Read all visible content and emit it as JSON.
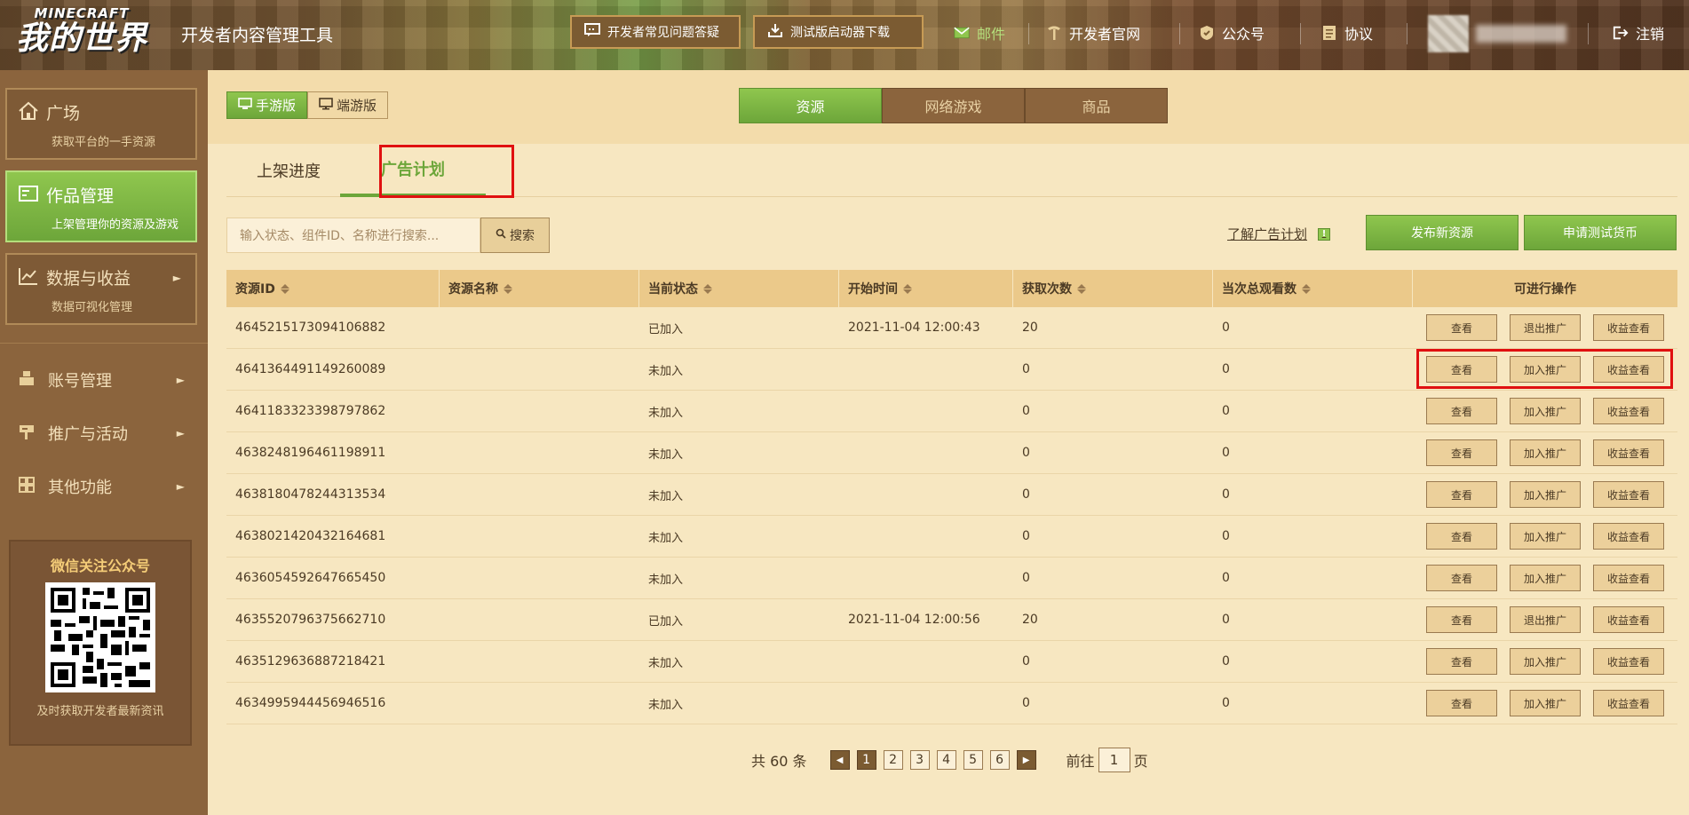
{
  "header": {
    "logo_en": "MINECRAFT",
    "logo_cn": "我的世界",
    "app_title": "开发者内容管理工具",
    "faq_btn": "开发者常见问题答疑",
    "download_btn": "测试版启动器下载",
    "mail": "邮件",
    "official_site": "开发者官网",
    "wechat_account": "公众号",
    "protocol": "协议",
    "logout": "注销"
  },
  "sidebar": {
    "plaza_title": "广场",
    "plaza_sub": "获取平台的一手资源",
    "works_title": "作品管理",
    "works_sub": "上架管理你的资源及游戏",
    "data_title": "数据与收益",
    "data_sub": "数据可视化管理",
    "account": "账号管理",
    "promo": "推广与活动",
    "other": "其他功能",
    "wechat_title": "微信关注公众号",
    "wechat_sub": "及时获取开发者最新资讯"
  },
  "platform": {
    "mobile": "手游版",
    "pc": "端游版"
  },
  "category_tabs": [
    "资源",
    "网络游戏",
    "商品"
  ],
  "tabs": {
    "progress": "上架进度",
    "ads": "广告计划"
  },
  "search": {
    "placeholder": "输入状态、组件ID、名称进行搜索...",
    "button": "搜索"
  },
  "learn_ads": "了解广告计划",
  "learn_icon": "!",
  "publish_btn": "发布新资源",
  "apply_btn": "申请测试货币",
  "table": {
    "headers": [
      "资源ID",
      "资源名称",
      "当前状态",
      "开始时间",
      "获取次数",
      "当次总观看数",
      "可进行操作"
    ],
    "rows": [
      {
        "id": "4645215173094106882",
        "name": "",
        "status": "已加入",
        "start": "2021-11-04 12:00:43",
        "count": "20",
        "views": "0",
        "ops": [
          "查看",
          "退出推广",
          "收益查看"
        ]
      },
      {
        "id": "4641364491149260089",
        "name": "",
        "status": "未加入",
        "start": "",
        "count": "0",
        "views": "0",
        "ops": [
          "查看",
          "加入推广",
          "收益查看"
        ]
      },
      {
        "id": "4641183323398797862",
        "name": "",
        "status": "未加入",
        "start": "",
        "count": "0",
        "views": "0",
        "ops": [
          "查看",
          "加入推广",
          "收益查看"
        ]
      },
      {
        "id": "4638248196461198911",
        "name": "",
        "status": "未加入",
        "start": "",
        "count": "0",
        "views": "0",
        "ops": [
          "查看",
          "加入推广",
          "收益查看"
        ]
      },
      {
        "id": "4638180478244313534",
        "name": "",
        "status": "未加入",
        "start": "",
        "count": "0",
        "views": "0",
        "ops": [
          "查看",
          "加入推广",
          "收益查看"
        ]
      },
      {
        "id": "4638021420432164681",
        "name": "",
        "status": "未加入",
        "start": "",
        "count": "0",
        "views": "0",
        "ops": [
          "查看",
          "加入推广",
          "收益查看"
        ]
      },
      {
        "id": "4636054592647665450",
        "name": "",
        "status": "未加入",
        "start": "",
        "count": "0",
        "views": "0",
        "ops": [
          "查看",
          "加入推广",
          "收益查看"
        ]
      },
      {
        "id": "4635520796375662710",
        "name": "",
        "status": "已加入",
        "start": "2021-11-04 12:00:56",
        "count": "20",
        "views": "0",
        "ops": [
          "查看",
          "退出推广",
          "收益查看"
        ]
      },
      {
        "id": "4635129636887218421",
        "name": "",
        "status": "未加入",
        "start": "",
        "count": "0",
        "views": "0",
        "ops": [
          "查看",
          "加入推广",
          "收益查看"
        ]
      },
      {
        "id": "4634995944456946516",
        "name": "",
        "status": "未加入",
        "start": "",
        "count": "0",
        "views": "0",
        "ops": [
          "查看",
          "加入推广",
          "收益查看"
        ]
      }
    ]
  },
  "pagination": {
    "total": "共 60 条",
    "pages": [
      "1",
      "2",
      "3",
      "4",
      "5",
      "6"
    ],
    "current": "1",
    "goto_label": "前往",
    "goto_value": "1",
    "page_suffix": "页"
  },
  "colors": {
    "accent_green": "#6da63a",
    "highlight_red": "#e01010",
    "brown": "#8b643d"
  }
}
